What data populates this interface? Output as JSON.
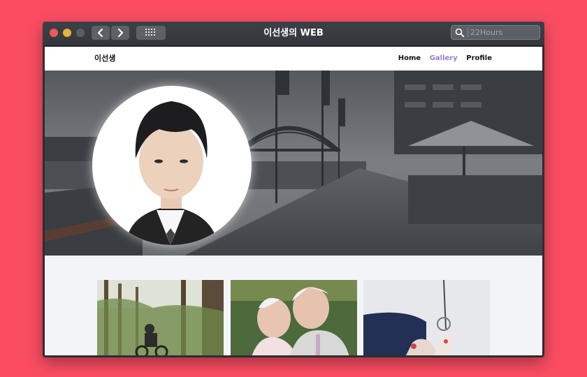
{
  "window": {
    "title": "이선생의 WEB",
    "search_placeholder": "22Hours"
  },
  "site": {
    "brand": "이선생",
    "menu": [
      {
        "label": "Home",
        "active": false
      },
      {
        "label": "Gallery",
        "active": true
      },
      {
        "label": "Profile",
        "active": false
      }
    ]
  },
  "colors": {
    "background": "#fb4d62",
    "accent": "#9b7ad6"
  },
  "icons": [
    "back-chevron-icon",
    "forward-chevron-icon",
    "grid-icon",
    "search-icon"
  ],
  "gallery": {
    "images": [
      {
        "subject": "forest-biker-photo"
      },
      {
        "subject": "elderly-couple-photo"
      },
      {
        "subject": "shoes-photo"
      }
    ]
  }
}
